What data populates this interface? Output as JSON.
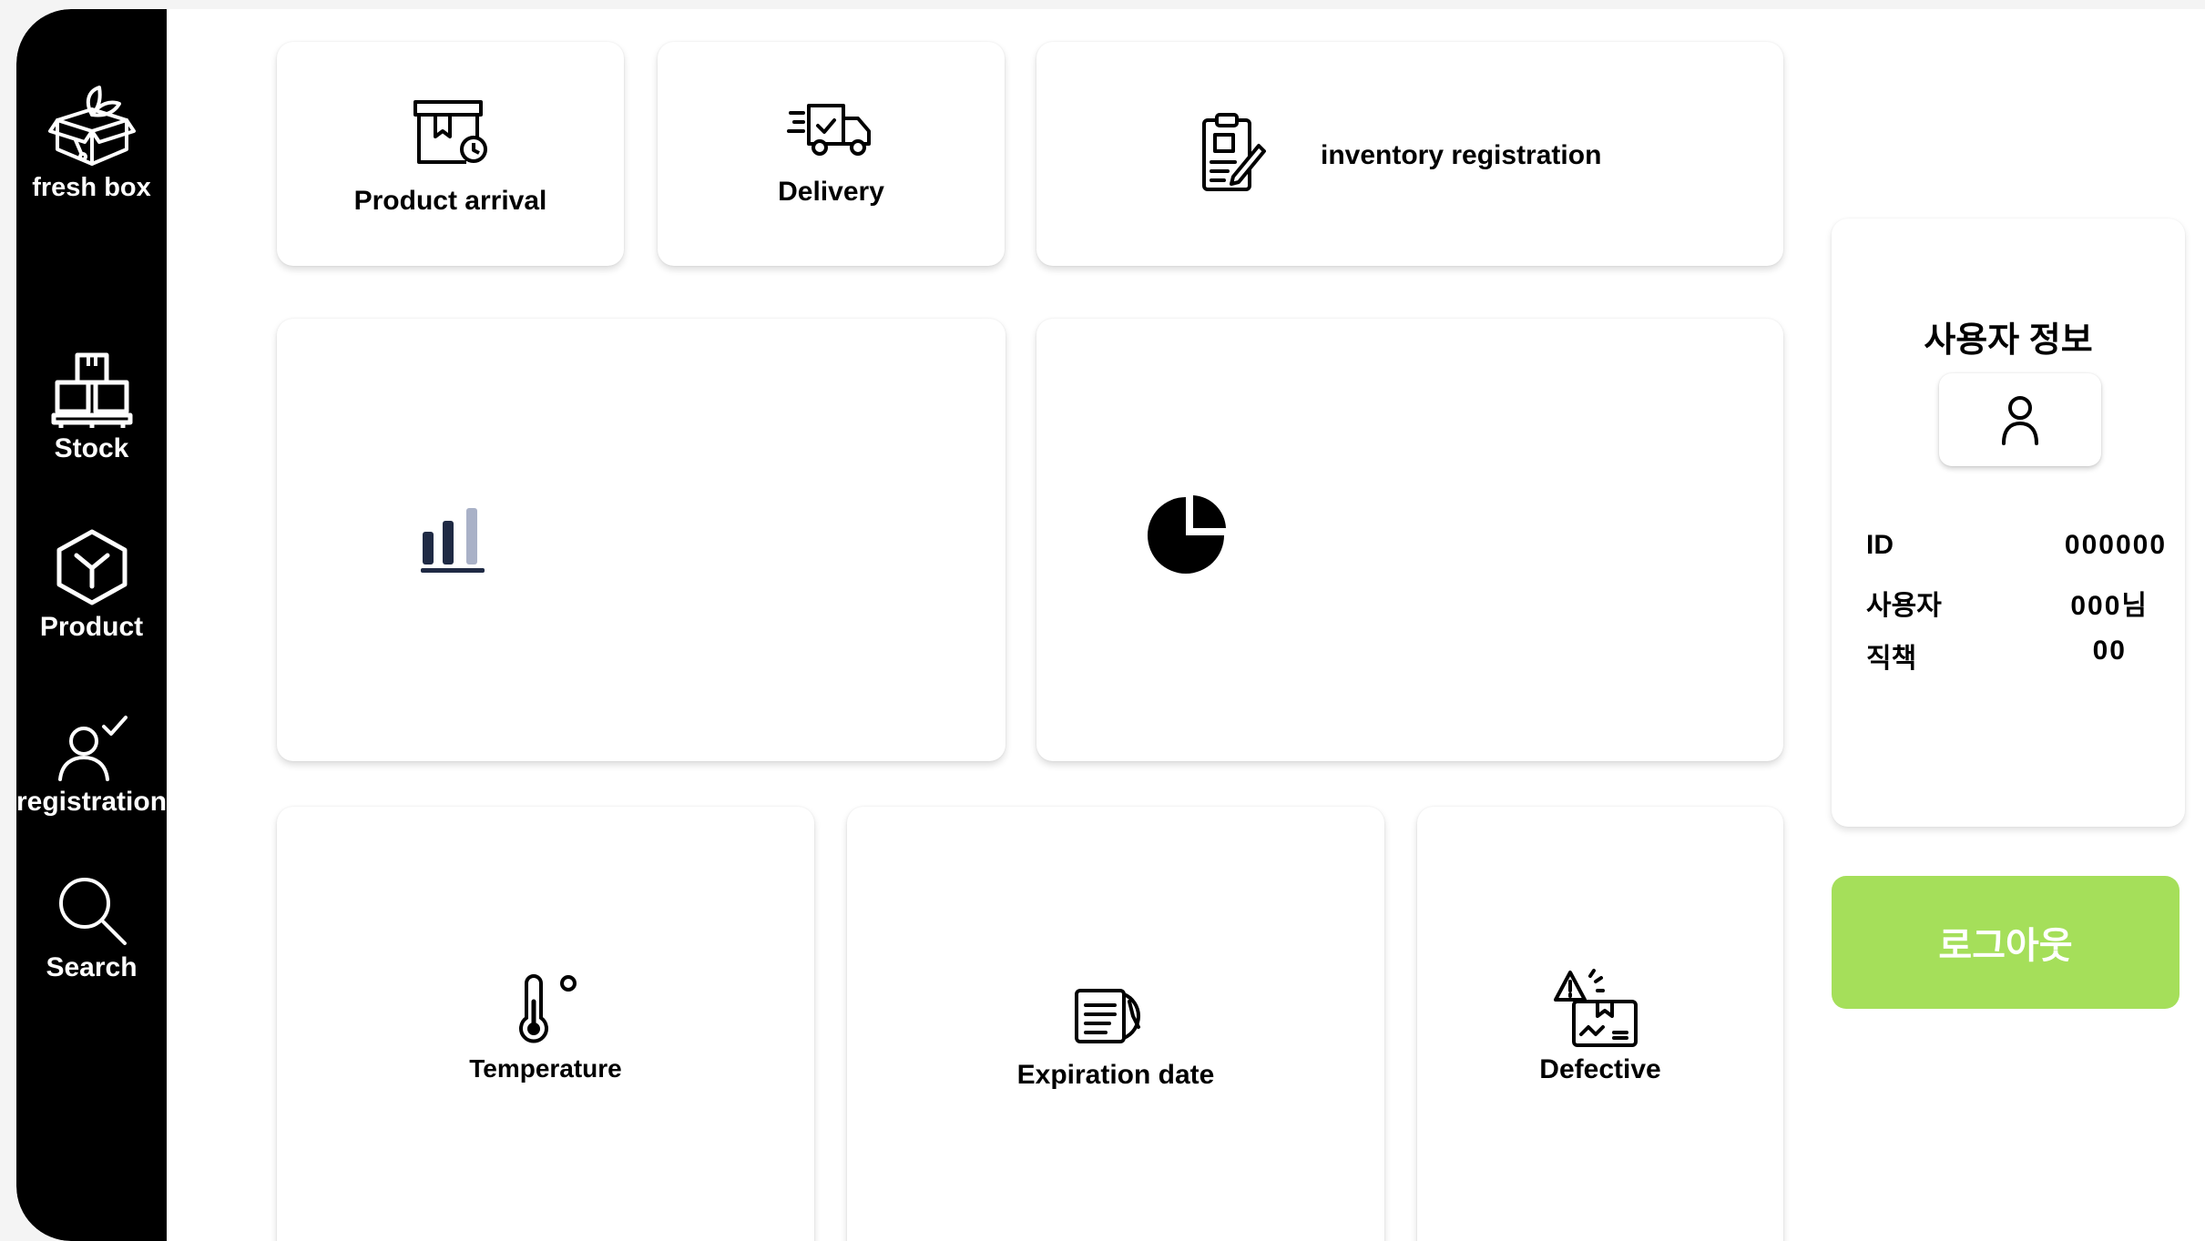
{
  "sidebar": {
    "brand": "fresh box",
    "items": [
      {
        "label": "Stock",
        "icon": "pallet-boxes-icon"
      },
      {
        "label": "Product",
        "icon": "cube-icon"
      },
      {
        "label": "registration",
        "icon": "user-check-icon"
      },
      {
        "label": "Search",
        "icon": "search-icon"
      }
    ]
  },
  "actions": {
    "product_arrival": "Product arrival",
    "delivery": "Delivery",
    "inventory_registration": "inventory registration"
  },
  "alerts": {
    "temperature": "Temperature",
    "expiration_date": "Expiration date",
    "defective": "Defective"
  },
  "user": {
    "title": "사용자 정보",
    "rows": [
      {
        "label": "ID",
        "value": "000000"
      },
      {
        "label": "사용자",
        "value": "000님"
      },
      {
        "label": "직책",
        "value": "00"
      }
    ]
  },
  "logout_label": "로그아웃",
  "colors": {
    "sidebar": "#000000",
    "logout": "#a5df5a",
    "bar_dark": "#1f2a44",
    "bar_light": "#a9b1c7"
  }
}
